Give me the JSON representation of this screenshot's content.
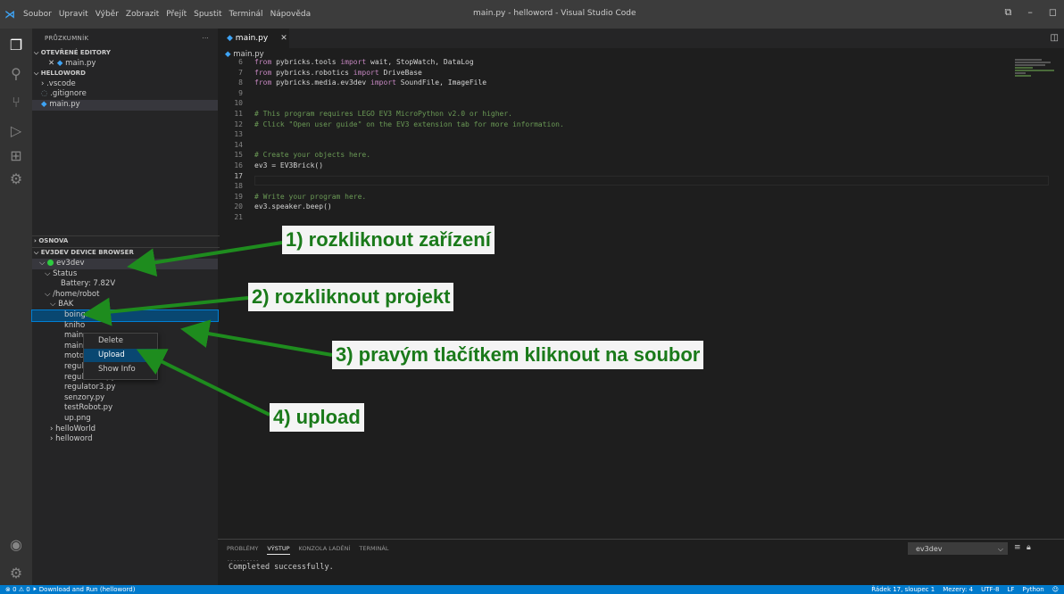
{
  "titlebar": {
    "menu": [
      "Soubor",
      "Upravit",
      "Výběr",
      "Zobrazit",
      "Přejít",
      "Spustit",
      "Terminál",
      "Nápověda"
    ],
    "window_title": "main.py - helloword - Visual Studio Code"
  },
  "sidebar": {
    "header": "PRŮZKUMNÍK",
    "more": "···",
    "open_editors": {
      "label": "OTEVŘENÉ EDITORY",
      "file": "main.py"
    },
    "workspace": {
      "label": "HELLOWORD",
      "items": [
        ".vscode",
        ".gitignore",
        "main.py"
      ]
    },
    "outline": "OSNOVA",
    "device_browser": {
      "label": "EV3DEV DEVICE BROWSER",
      "device": "ev3dev",
      "status": "Status",
      "battery": "Battery: 7.82V",
      "home": "/home/robot",
      "folder": "BAK",
      "files": [
        "boing.wav",
        "kniho",
        "main.",
        "main.",
        "moto",
        "regulator.py",
        "regulator2.py",
        "regulator3.py",
        "senzory.py",
        "testRobot.py",
        "up.png"
      ],
      "folders": [
        "helloWorld",
        "helloword"
      ]
    }
  },
  "context_menu": {
    "items": [
      "Delete",
      "Upload",
      "Show Info"
    ],
    "active": "Upload"
  },
  "editor": {
    "tab": "main.py",
    "breadcrumb": "main.py",
    "current_line": "17",
    "lines": [
      {
        "n": "6",
        "kind": "import",
        "pre": "from pybricks.tools ",
        "kw": "import",
        "post": " wait, StopWatch, DataLog"
      },
      {
        "n": "7",
        "kind": "import",
        "pre": "from pybricks.robotics ",
        "kw": "import",
        "post": " DriveBase"
      },
      {
        "n": "8",
        "kind": "import",
        "pre": "from pybricks.media.ev3dev ",
        "kw": "import",
        "post": " SoundFile, ImageFile"
      },
      {
        "n": "9",
        "kind": "blank",
        "text": ""
      },
      {
        "n": "10",
        "kind": "blank",
        "text": ""
      },
      {
        "n": "11",
        "kind": "comment",
        "text": "# This program requires LEGO EV3 MicroPython v2.0 or higher."
      },
      {
        "n": "12",
        "kind": "comment",
        "text": "# Click \"Open user guide\" on the EV3 extension tab for more information."
      },
      {
        "n": "13",
        "kind": "blank",
        "text": ""
      },
      {
        "n": "14",
        "kind": "blank",
        "text": ""
      },
      {
        "n": "15",
        "kind": "comment",
        "text": "# Create your objects here."
      },
      {
        "n": "16",
        "kind": "code",
        "text": "ev3 = EV3Brick()"
      },
      {
        "n": "17",
        "kind": "blank",
        "text": ""
      },
      {
        "n": "18",
        "kind": "blank",
        "text": ""
      },
      {
        "n": "19",
        "kind": "comment",
        "text": "# Write your program here."
      },
      {
        "n": "20",
        "kind": "code",
        "text": "ev3.speaker.beep()"
      },
      {
        "n": "21",
        "kind": "blank",
        "text": ""
      }
    ]
  },
  "panel": {
    "tabs": [
      "PROBLÉMY",
      "VÝSTUP",
      "KONZOLA LADĚNÍ",
      "TERMINÁL"
    ],
    "active_tab": "VÝSTUP",
    "select": "ev3dev",
    "separator": "----------",
    "output": "Completed successfully."
  },
  "statusbar": {
    "left": "⊗ 0 ⚠ 0   ⯈ Download and Run (helloword)",
    "right": [
      "Řádek 17, sloupec 1",
      "Mezery: 4",
      "UTF-8",
      "LF",
      "Python",
      "☺"
    ]
  },
  "callouts": [
    "1) rozkliknout zařízení",
    "2) rozkliknout projekt",
    "3) pravým tlačítkem kliknout na soubor",
    "4) upload"
  ],
  "colors": {
    "accent": "#007acc",
    "callout_text": "#1a7a1a",
    "arrow": "#1e8c1e"
  }
}
